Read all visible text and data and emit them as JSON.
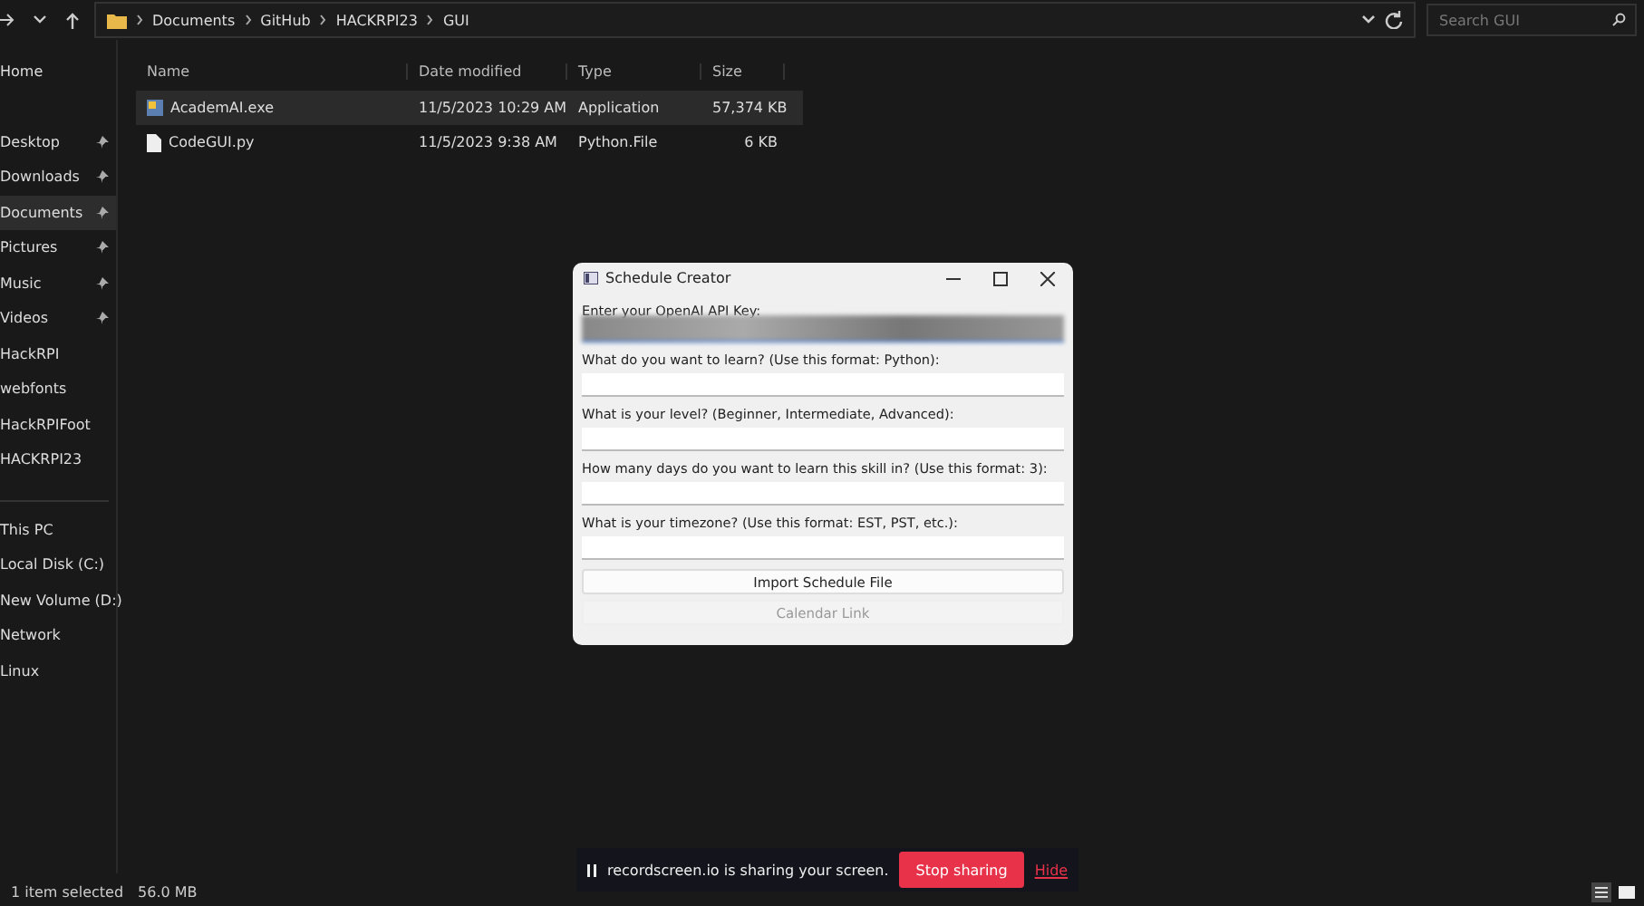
{
  "address_bar": {
    "path": [
      "Documents",
      "GitHub",
      "HACKRPI23",
      "GUI"
    ]
  },
  "search": {
    "placeholder": "Search GUI"
  },
  "sidebar": {
    "items": [
      {
        "label": "Home",
        "pinned": false,
        "selected": false
      },
      {
        "label": "Desktop",
        "pinned": true,
        "selected": false
      },
      {
        "label": "Downloads",
        "pinned": true,
        "selected": false
      },
      {
        "label": "Documents",
        "pinned": true,
        "selected": true
      },
      {
        "label": "Pictures",
        "pinned": true,
        "selected": false
      },
      {
        "label": "Music",
        "pinned": true,
        "selected": false
      },
      {
        "label": "Videos",
        "pinned": true,
        "selected": false
      },
      {
        "label": "HackRPI",
        "pinned": false,
        "selected": false
      },
      {
        "label": "webfonts",
        "pinned": false,
        "selected": false
      },
      {
        "label": "HackRPIFoot",
        "pinned": false,
        "selected": false
      },
      {
        "label": "HACKRPI23",
        "pinned": false,
        "selected": false
      }
    ],
    "places": [
      {
        "label": "This PC"
      },
      {
        "label": "Local Disk (C:)"
      },
      {
        "label": "New Volume (D:)"
      },
      {
        "label": "Network"
      },
      {
        "label": "Linux"
      }
    ]
  },
  "table": {
    "columns": [
      "Name",
      "Date modified",
      "Type",
      "Size"
    ],
    "rows": [
      {
        "kind": "app",
        "name": "AcademAI.exe",
        "date": "11/5/2023 10:29 AM",
        "type": "Application",
        "size": "57,374 KB",
        "selected": true
      },
      {
        "kind": "file",
        "name": "CodeGUI.py",
        "date": "11/5/2023 9:38 AM",
        "type": "Python.File",
        "size": "6 KB",
        "selected": false
      }
    ]
  },
  "dialog": {
    "title": "Schedule Creator",
    "fields": [
      {
        "label": "Enter your OpenAI API Key:",
        "blurred": true
      },
      {
        "label": "What do you want to learn? (Use this format: Python):",
        "blurred": false
      },
      {
        "label": "What is your level? (Beginner, Intermediate, Advanced):",
        "blurred": false
      },
      {
        "label": "How many days do you want to learn this skill in? (Use this format: 3):",
        "blurred": false
      },
      {
        "label": "What is your timezone? (Use this format: EST, PST, etc.):",
        "blurred": false
      }
    ],
    "buttons": [
      {
        "label": "Import Schedule File",
        "disabled": false
      },
      {
        "label": "Calendar Link",
        "disabled": true
      }
    ]
  },
  "status_bar": {
    "selection": "1 item selected",
    "size": "56.0 MB"
  },
  "sharing_bar": {
    "message": "recordscreen.io is sharing your screen.",
    "stop": "Stop sharing",
    "hide": "Hide"
  }
}
